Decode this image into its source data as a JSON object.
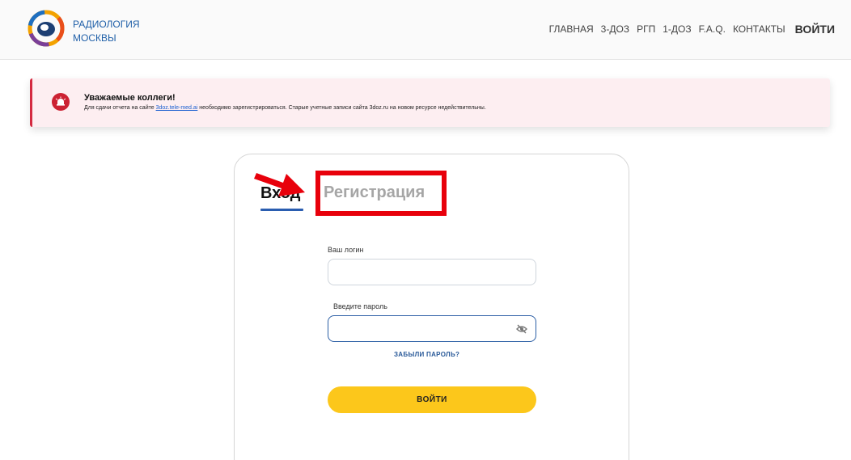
{
  "header": {
    "logo_line1": "РАДИОЛОГИЯ",
    "logo_line2": "МОСКВЫ",
    "nav": [
      "ГЛАВНАЯ",
      "3-ДОЗ",
      "РГП",
      "1-ДОЗ",
      "F.A.Q.",
      "КОНТАКТЫ"
    ],
    "login_label": "ВОЙТИ"
  },
  "alert": {
    "title": "Уважаемые коллеги!",
    "text_before": "Для сдачи отчета на сайте ",
    "link": "3doz.tele-med.ai",
    "text_after": " необходимо зарегистрироваться. Старые учетные записи сайта 3doz.ru на новом ресурсе недействительны.",
    "icon": "alarm-icon",
    "accent_color": "#d42a41"
  },
  "form": {
    "tab_login": "Вход",
    "tab_register": "Регистрация",
    "login_label": "Ваш логин",
    "login_value": "",
    "password_label": "Введите пароль",
    "password_value": "",
    "forgot_label": "ЗАБЫЛИ ПАРОЛЬ?",
    "submit_label": "ВОЙТИ",
    "submit_color": "#fcc71b"
  },
  "annotations": {
    "highlight_color": "#e8000b",
    "arrow_icon": "red-arrow-icon"
  }
}
